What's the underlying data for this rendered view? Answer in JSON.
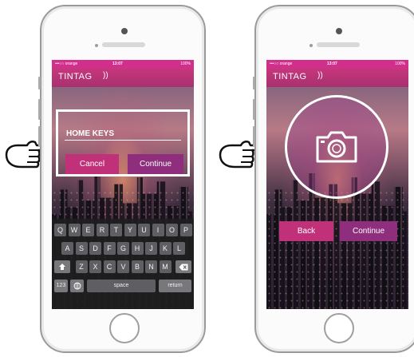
{
  "status_bar": {
    "carrier": "•••○○ orange",
    "time": "13:07",
    "battery": "100%"
  },
  "app": {
    "logo_text": "TINTAG",
    "logo_waves": "))"
  },
  "left_screen": {
    "key_name_value": "HOME KEYS",
    "cancel_label": "Cancel",
    "continue_label": "Continue"
  },
  "keyboard": {
    "row1": [
      "Q",
      "W",
      "E",
      "R",
      "T",
      "Y",
      "U",
      "I",
      "O",
      "P"
    ],
    "row2": [
      "A",
      "S",
      "D",
      "F",
      "G",
      "H",
      "J",
      "K",
      "L"
    ],
    "row3": [
      "Z",
      "X",
      "C",
      "V",
      "B",
      "N",
      "M"
    ],
    "numbers_label": "123",
    "space_label": "space",
    "return_label": "return"
  },
  "right_screen": {
    "back_label": "Back",
    "continue_label": "Continue"
  },
  "colors": {
    "brand_pink": "#c1317a",
    "brand_purple": "#8e2e7c",
    "status_bar": "#d22e8c"
  },
  "icons": {
    "pointer_hand": "pointing-hand-icon",
    "camera": "camera-icon",
    "shift": "shift-icon",
    "backspace": "backspace-icon",
    "globe": "globe-icon"
  }
}
